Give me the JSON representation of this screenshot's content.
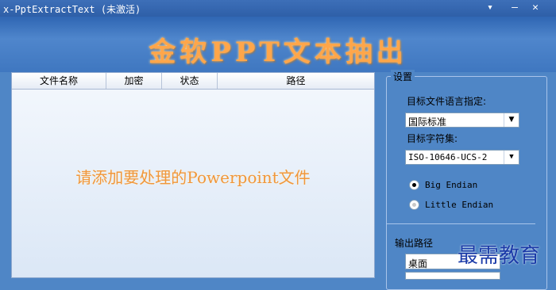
{
  "window": {
    "title": "x-PptExtractText (未激活)",
    "menu_glyph": "▾",
    "min_glyph": "—",
    "close_glyph": "✕"
  },
  "banner": {
    "app_title": "金软PPT文本抽出"
  },
  "file_list": {
    "columns": [
      "文件名称",
      "加密",
      "状态",
      "路径"
    ],
    "placeholder": "请添加要处理的Powerpoint文件"
  },
  "settings": {
    "legend": "设置",
    "target_language_label": "目标文件语言指定:",
    "target_language_value": "国际标准",
    "charset_label": "目标字符集:",
    "charset_value": "ISO-10646-UCS-2",
    "endian_options": [
      {
        "label": "Big Endian",
        "selected": true
      },
      {
        "label": "Little Endian",
        "selected": false
      }
    ],
    "output_path_label": "输出路径",
    "output_path_value": "桌面"
  },
  "watermark": "最需教育",
  "colors": {
    "title_orange": "#ffa64a",
    "background_blue": "#4f86c6"
  }
}
